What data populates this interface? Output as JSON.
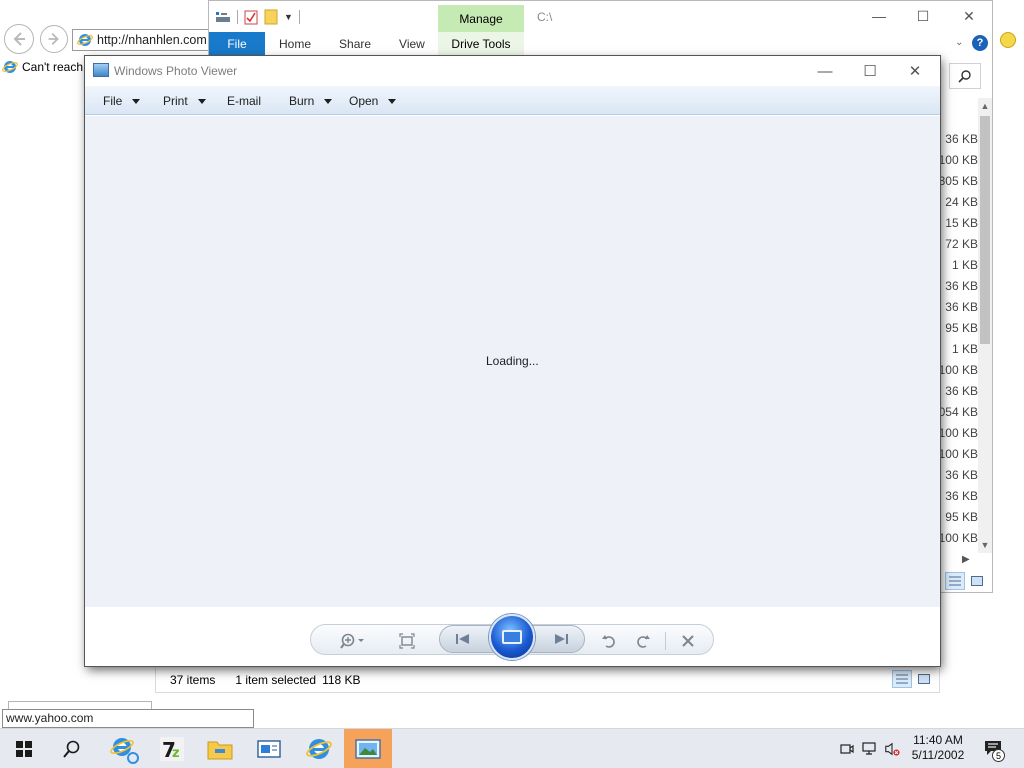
{
  "ie": {
    "address": "http://nhanhlen.com",
    "tab_title": "Can't reach"
  },
  "explorer": {
    "manage_tab": "Manage",
    "drive_tools_tab": "Drive Tools",
    "path": "C:\\",
    "ribbon_tabs": [
      "File",
      "Home",
      "Share",
      "View"
    ],
    "help": "?",
    "sizes": [
      "36 KB",
      "100 KB",
      "305 KB",
      "24 KB",
      "15 KB",
      "72 KB",
      "1 KB",
      "36 KB",
      "36 KB",
      "95 KB",
      "1 KB",
      "100 KB",
      "36 KB",
      "054 KB",
      "100 KB",
      "100 KB",
      "36 KB",
      "36 KB",
      "95 KB",
      "100 KB"
    ],
    "status": {
      "items": "37 items",
      "selected": "1 item selected",
      "selected_size": "118 KB"
    }
  },
  "photo_viewer": {
    "title": "Windows Photo Viewer",
    "menu": {
      "file": "File",
      "print": "Print",
      "email": "E-mail",
      "burn": "Burn",
      "open": "Open"
    },
    "help": "?",
    "loading": "Loading..."
  },
  "status_url": "www.yahoo.com",
  "taskbar": {
    "time": "11:40 AM",
    "date": "5/11/2002",
    "notification_count": "5",
    "accent": "#f7a25a"
  }
}
